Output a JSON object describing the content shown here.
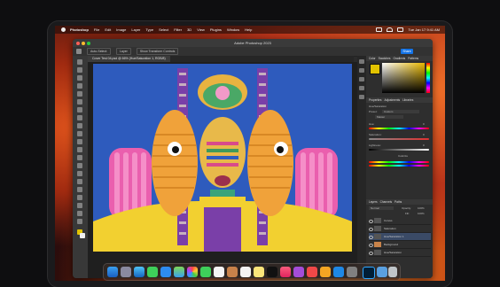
{
  "menubar": {
    "app": "Photoshop",
    "items": [
      "File",
      "Edit",
      "Image",
      "Layer",
      "Type",
      "Select",
      "Filter",
      "3D",
      "View",
      "Plugins",
      "Window",
      "Help"
    ],
    "clock": "Tue Jan 17 9:41 AM"
  },
  "window": {
    "title": "Adobe Photoshop 2023"
  },
  "options": {
    "auto_select": "Auto-Select:",
    "layer": "Layer",
    "transform": "Show Transform Controls",
    "share": "Share"
  },
  "document": {
    "tab": "Cover Test 04.psd @ 66% (Hue/Saturation 1, RGB/8)"
  },
  "panels": {
    "color": {
      "tabs": [
        "Color",
        "Swatches",
        "Gradients",
        "Patterns"
      ]
    },
    "properties": {
      "tabs": [
        "Properties",
        "Adjustments",
        "Libraries"
      ],
      "adjustment": "Hue/Saturation",
      "preset_label": "Preset:",
      "preset": "Custom",
      "channel": "Master",
      "rows": [
        "Hue:",
        "Saturation:",
        "Lightness:"
      ],
      "values": [
        "0",
        "0",
        "0"
      ],
      "colorize": "Colorize"
    },
    "layers": {
      "tabs": [
        "Layers",
        "Channels",
        "Paths"
      ],
      "blend": "Normal",
      "opacity_label": "Opacity:",
      "opacity": "100%",
      "fill_label": "Fill:",
      "fill": "100%",
      "items": [
        "Curves",
        "Saturation",
        "Hue/Saturation 1",
        "Background",
        "Hue/Saturation"
      ]
    }
  },
  "colors": {
    "accent": "#1473e6",
    "wallpaper": "#e0541c"
  }
}
